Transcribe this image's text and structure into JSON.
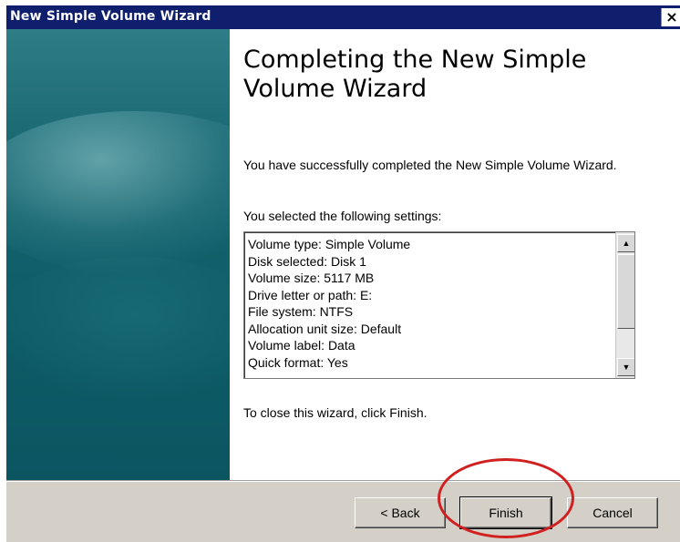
{
  "window": {
    "title": "New Simple Volume Wizard",
    "close_glyph": "×"
  },
  "content": {
    "heading": "Completing the New Simple Volume Wizard",
    "success_text": "You have successfully completed the New Simple Volume Wizard.",
    "settings_intro": "You selected the following settings:",
    "settings": [
      "Volume type: Simple Volume",
      "Disk selected: Disk 1",
      "Volume size: 5117 MB",
      "Drive letter or path: E:",
      "File system: NTFS",
      "Allocation unit size: Default",
      "Volume label: Data",
      "Quick format: Yes"
    ],
    "close_instruction": "To close this wizard, click Finish."
  },
  "scrollbar": {
    "up_glyph": "▲",
    "down_glyph": "▼"
  },
  "buttons": {
    "back": "< Back",
    "finish": "Finish",
    "cancel": "Cancel"
  },
  "colors": {
    "titlebar": "#0f1f6e",
    "banner": "#15656f",
    "highlight": "#d02020",
    "footer": "#d4d0c8"
  }
}
